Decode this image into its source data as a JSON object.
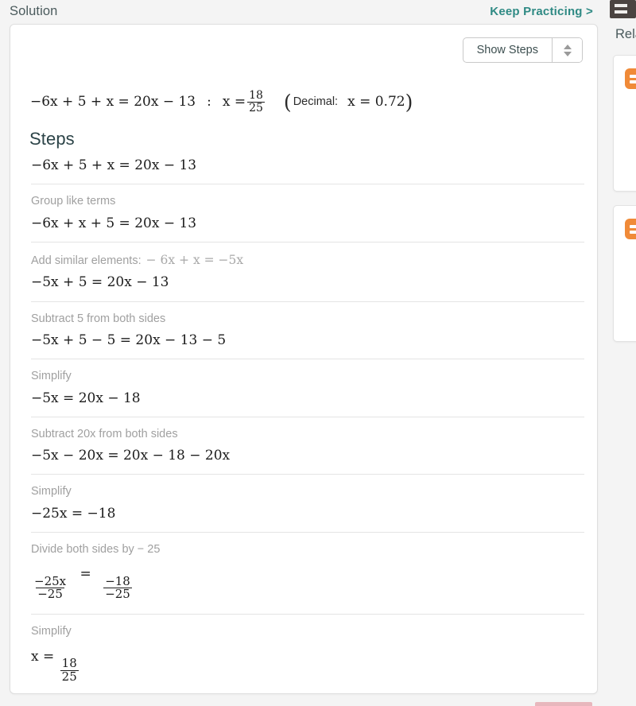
{
  "header": {
    "title": "Solution",
    "keep_practicing_label": "Keep Practicing >",
    "link_color": "#2f8a84"
  },
  "toolbar": {
    "show_steps_label": "Show Steps",
    "spinner_icon": "spinner-up-down-icon"
  },
  "result": {
    "equation": "−6x + 5 + x = 20x − 13",
    "separator": ":",
    "solution_lhs": "x =",
    "solution_numerator": "18",
    "solution_denominator": "25",
    "decimal_open_paren": "(",
    "decimal_word": "Decimal:",
    "decimal_value": "x = 0.72",
    "decimal_close_paren": ")"
  },
  "steps_section": {
    "heading": "Steps",
    "initial_expression": "−6x + 5 + x = 20x − 13",
    "steps": [
      {
        "label": "Group like terms",
        "label_math": "",
        "expression": "−6x + x + 5 = 20x − 13"
      },
      {
        "label": "Add similar elements:",
        "label_math": "− 6x + x = −5x",
        "expression": "−5x + 5 = 20x − 13"
      },
      {
        "label": "Subtract 5 from both sides",
        "label_math": "",
        "expression": "−5x + 5 − 5 = 20x − 13 − 5"
      },
      {
        "label": "Simplify",
        "label_math": "",
        "expression": "−5x = 20x − 18"
      },
      {
        "label": "Subtract 20x from both sides",
        "label_math": "",
        "expression": "−5x − 20x = 20x − 18 − 20x"
      },
      {
        "label": "Simplify",
        "label_math": "",
        "expression": "−25x = −18"
      },
      {
        "label": "Divide both sides by − 25",
        "label_math": "",
        "expression": "",
        "fraction_equation": {
          "left_num": "−25x",
          "left_den": "−25",
          "operator": "=",
          "right_num": "−18",
          "right_den": "−25"
        }
      },
      {
        "label": "Simplify",
        "label_math": "",
        "expression": "",
        "final_answer": {
          "lhs": "x =",
          "numerator": "18",
          "denominator": "25"
        }
      }
    ]
  },
  "sidebar": {
    "related_heading": "Rela",
    "cards": [
      {
        "icon": "orange-badge-icon"
      },
      {
        "icon": "orange-badge-icon"
      }
    ]
  },
  "colors": {
    "page_background": "#f4f4f4",
    "card_background": "#ffffff",
    "accent_teal": "#2f8a84",
    "accent_orange": "#f08a38",
    "label_gray": "#a0a0a0",
    "heading_slate": "#2c4448"
  }
}
